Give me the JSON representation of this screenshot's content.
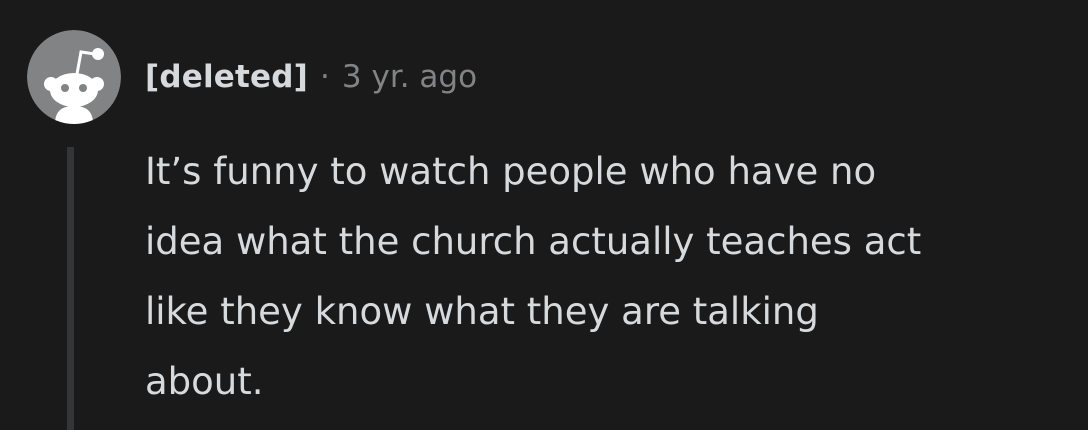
{
  "comment": {
    "author": "[deleted]",
    "separator": "·",
    "timestamp": "3 yr. ago",
    "avatar_icon": "reddit-snoo-icon",
    "body_lines": [
      "It’s funny to watch people who have no",
      "idea what the church actually teaches act",
      "like they know what they are talking",
      "about."
    ]
  },
  "colors": {
    "background": "#1a1a1b",
    "text": "#d7dadc",
    "meta_text": "#818384",
    "thread_line": "#343536",
    "avatar_bg": "#818384",
    "avatar_figure": "#ffffff"
  }
}
